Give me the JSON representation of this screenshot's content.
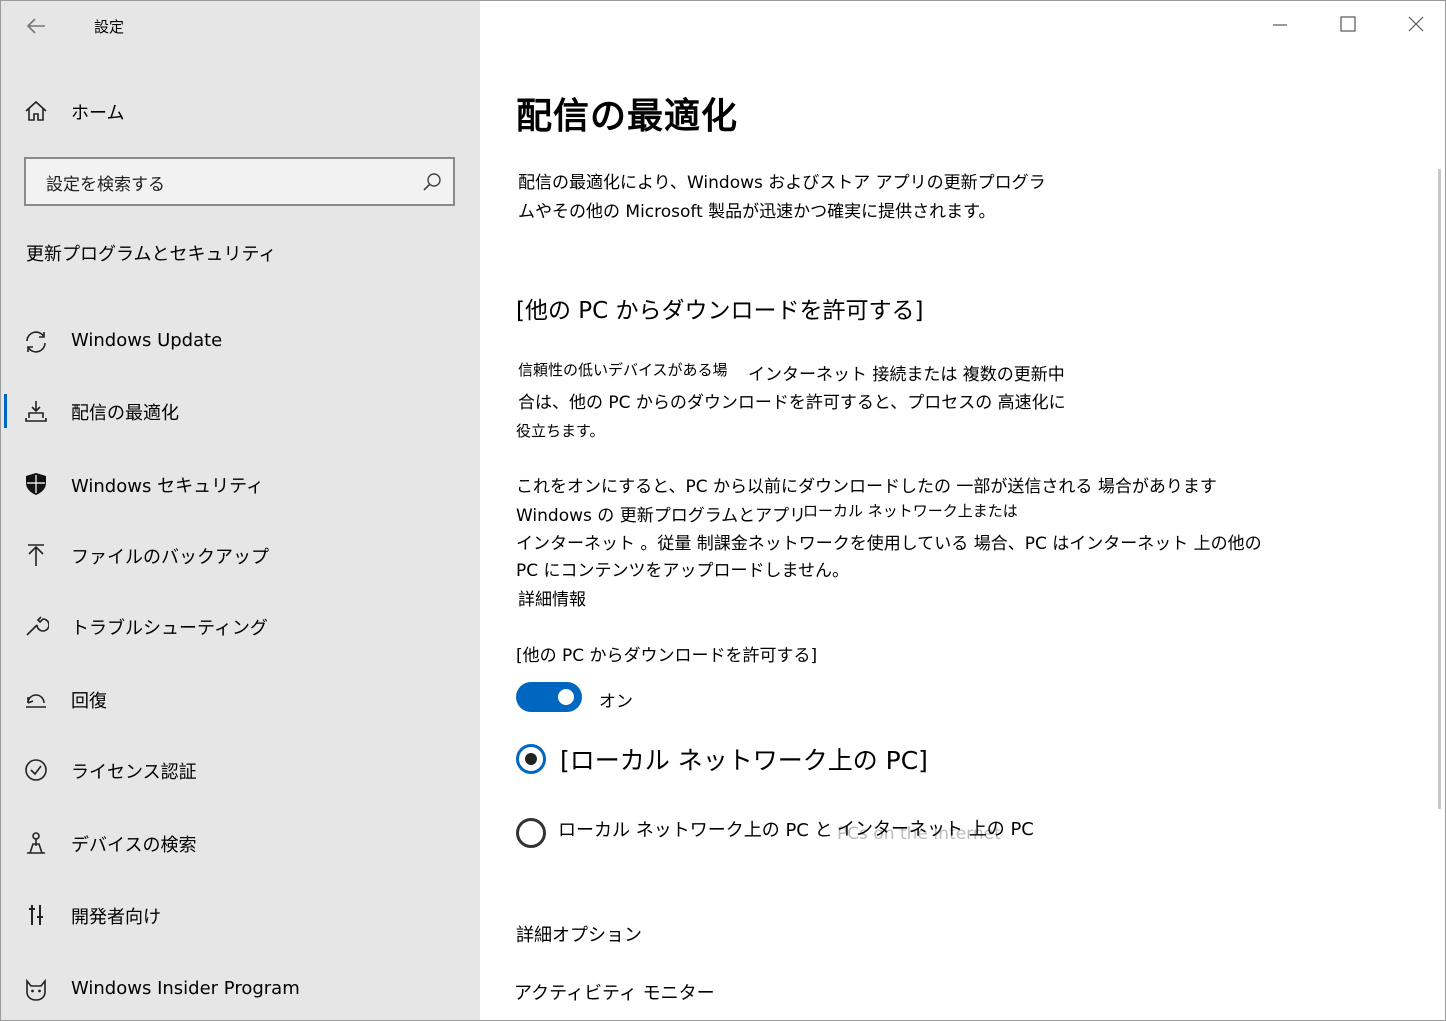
{
  "window": {
    "title": "設定",
    "controls": [
      "minimize-icon",
      "maximize-icon",
      "close-icon"
    ]
  },
  "sidebar": {
    "home_label": "ホーム",
    "search": {
      "placeholder": "設定を検索する"
    },
    "section_title": "更新プログラムとセキュリティ",
    "items": [
      {
        "label": "Windows Update",
        "icon": "sync-icon",
        "selected": false
      },
      {
        "label": "配信の最適化",
        "icon": "delivery-icon",
        "selected": true
      },
      {
        "label": "Windows セキュリティ",
        "icon": "shield-icon",
        "selected": false
      },
      {
        "label": "ファイルのバックアップ",
        "icon": "backup-arrow-icon",
        "selected": false
      },
      {
        "label": "トラブルシューティング",
        "icon": "wrench-icon",
        "selected": false
      },
      {
        "label": "回復",
        "icon": "recovery-icon",
        "selected": false
      },
      {
        "label": "ライセンス認証",
        "icon": "check-circle-icon",
        "selected": false
      },
      {
        "label": "デバイスの検索",
        "icon": "find-device-icon",
        "selected": false
      },
      {
        "label": "開発者向け",
        "icon": "developer-icon",
        "selected": false
      },
      {
        "label": "Windows Insider Program",
        "icon": "insider-cat-icon",
        "selected": false
      }
    ]
  },
  "main": {
    "title": "配信の最適化",
    "description_line1": "配信の最適化により、Windows およびストア アプリの更新プログラ",
    "description_line2": "ムやその他の Microsoft 製品が迅速かつ確実に提供されます。",
    "section_heading": "[他の PC からダウンロードを許可する]",
    "para1_part1": "信頼性の低いデバイスがある場",
    "para1_part2": "インターネット 接続または 複数の更新中",
    "para1_line2": "合は、他の PC からのダウンロードを許可すると、プロセスの 高速化に",
    "para1_line3": "役立ちます。",
    "para2_line1": "これをオンにすると、PC から以前にダウンロードしたの 一部が送信される 場合があります",
    "para2_line2a": "Windows の 更新プログラムとアプリ",
    "para2_line2b": "ローカル ネットワーク上または",
    "para2_line3": "インターネット 。従量 制課金ネットワークを使用している 場合、PC はインターネット 上の他の",
    "para2_line4": "PC にコンテンツをアップロードしません。",
    "more_info_link": "詳細情報",
    "toggle_label": "[他の PC からダウンロードを許可する]",
    "toggle_state": "オン",
    "toggle_on": true,
    "radio_local": "[ローカル ネットワーク上の PC]",
    "radio_internet_part1": "ローカル ネットワーク上の  PC と",
    "radio_internet_part2": "インターネット 上の PC",
    "radio_internet_ghost": "PCs on the Internet",
    "advanced_options": "詳細オプション",
    "activity_monitor": "アクティビティ モニター",
    "accent_color": "#0067c0"
  }
}
